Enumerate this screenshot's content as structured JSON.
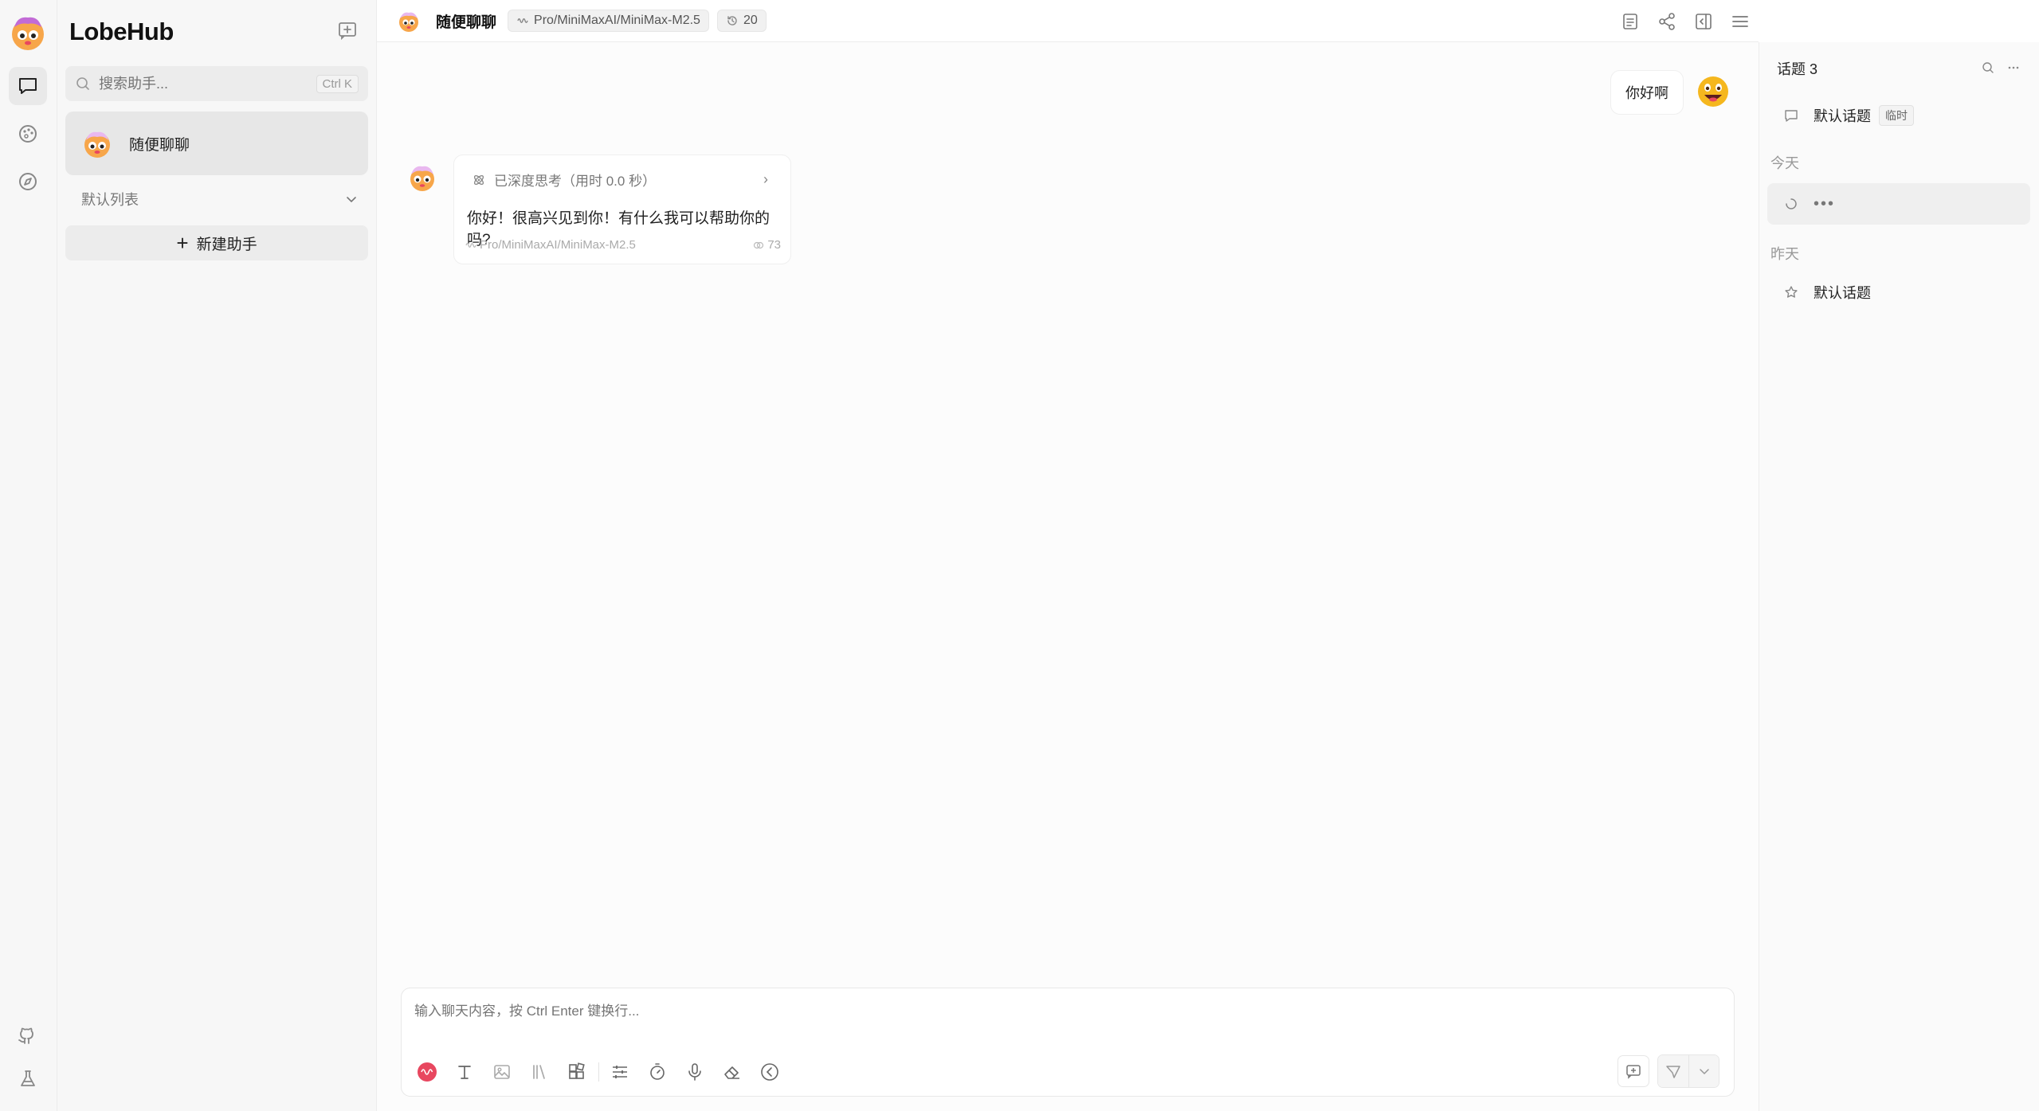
{
  "app": {
    "brand": "LobeHub"
  },
  "sidebar": {
    "search_placeholder": "搜索助手...",
    "search_shortcut": "Ctrl K",
    "sessions": [
      {
        "name": "随便聊聊"
      }
    ],
    "group_label": "默认列表",
    "new_assistant_label": "新建助手"
  },
  "chat": {
    "title": "随便聊聊",
    "model_tag": "Pro/MiniMaxAI/MiniMax-M2.5",
    "history_count": "20",
    "messages": [
      {
        "role": "user",
        "text": "你好啊"
      },
      {
        "role": "assistant",
        "thinking_label": "已深度思考（用时 0.0 秒）",
        "text": "你好！很高兴见到你！有什么我可以帮助你的吗?",
        "model": "Pro/MiniMaxAI/MiniMax-M2.5",
        "tokens": "73"
      }
    ],
    "input_placeholder": "输入聊天内容，按 Ctrl Enter 键换行..."
  },
  "topics": {
    "header": "话题 3",
    "pinned": {
      "label": "默认话题",
      "badge": "临时"
    },
    "groups": [
      {
        "label": "今天",
        "items": [
          {
            "label": "•••",
            "loading": true
          }
        ]
      },
      {
        "label": "昨天",
        "items": [
          {
            "label": "默认话题"
          }
        ]
      }
    ]
  },
  "colors": {
    "accent_logo": "#e8475f",
    "bg_sidebar": "#f7f7f7",
    "bg_active": "#e7e7e7"
  }
}
